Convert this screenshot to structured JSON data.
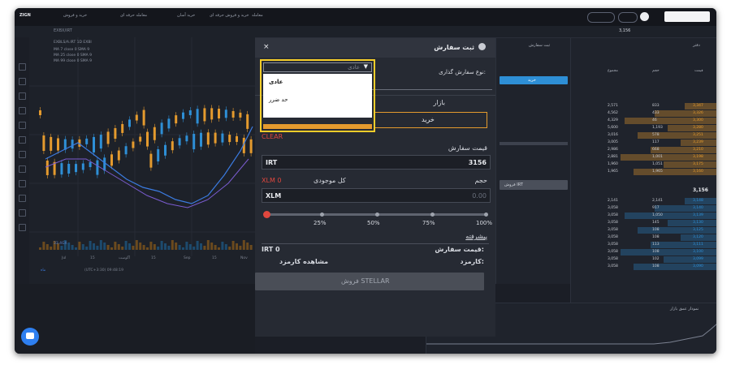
{
  "colors": {
    "accent": "#f5cd2a",
    "buy_orange": "#e49a2e",
    "sell_blue": "#2e8fd6",
    "clear_red": "#e0473e",
    "modal_bg": "#262a33",
    "page_bg": "#1b1e26"
  },
  "topbar": {
    "logo": "ZIGN",
    "items": [
      "خرید و فروش",
      "معامله حرفه ای",
      "خرید آسان",
      "خرید و فروش حرفه ای",
      "معامله"
    ]
  },
  "chart": {
    "pair": "EXBX/IRT",
    "ticker_row": "EXBLS/A.IRT 1D EXBI",
    "ind1": "MA 7 close 0 SMA 9",
    "ind2": "MA 25 close 0 SMA 9",
    "ind3": "MA 99 close 0 SMA 9",
    "volume": "33.4GX",
    "x_ticks": [
      "Jul",
      "15",
      "آگوست",
      "15",
      "Sep",
      "15",
      "Nov"
    ],
    "footer": "(UTC+3:30) 09:48:19",
    "footer_left": "ماه"
  },
  "modal": {
    "title": "ثبت سفارش",
    "close_icon": "×",
    "order_type_label": "نوع سفارش گذاری:",
    "order_type_value": "عادی",
    "dropdown_options": [
      "عادی",
      "حد ضرر"
    ],
    "market_tab": "بازار",
    "buy_tab": "خرید",
    "clear_label": "CLEAR",
    "price_label": "قیمت سفارش",
    "price_currency": "IRT",
    "price_value": "3156",
    "volume_label": "حجم",
    "balance_label": "کل موجودی",
    "balance_value": "XLM 0",
    "volume_currency": "XLM",
    "volume_value": "0.00",
    "slider_marks": [
      "25%",
      "50%",
      "75%",
      "100%"
    ],
    "slider_value": 0,
    "advanced_link": "پیشرفته",
    "order_price_label": "قیمت سفارش:",
    "order_price_value": "IRT 0",
    "fee_label": "کارمزد:",
    "fee_value": "مشاهده کارمزد",
    "sell_button": "فروش STELLAR"
  },
  "orderbook": {
    "title": "دفتر",
    "headers": [
      "قیمت",
      "حجم",
      "مجموع"
    ],
    "last_price": "3,156",
    "asks": [
      [
        "3,347",
        "833",
        "2,571"
      ],
      [
        "3,326",
        "433",
        "4,562"
      ],
      [
        "3,300",
        "46",
        "4,329"
      ],
      [
        "3,280",
        "1,193",
        "5,600"
      ],
      [
        "3,251",
        "578",
        "3,016"
      ],
      [
        "3,239",
        "117",
        "3,005"
      ],
      [
        "3,210",
        "668",
        "2,986"
      ],
      [
        "3,198",
        "1,001",
        "2,881"
      ],
      [
        "3,175",
        "1,051",
        "1,960"
      ],
      [
        "3,160",
        "1,965",
        "1,965"
      ]
    ],
    "bids": [
      [
        "3,148",
        "2,141",
        "2,141"
      ],
      [
        "3,140",
        "917",
        "3,058"
      ],
      [
        "3,139",
        "1,050",
        "3,058"
      ],
      [
        "3,130",
        "145",
        "3,058"
      ],
      [
        "3,125",
        "108",
        "3,058"
      ],
      [
        "3,120",
        "108",
        "3,058"
      ],
      [
        "3,111",
        "113",
        "3,058"
      ],
      [
        "3,100",
        "108",
        "3,058"
      ],
      [
        "3,099",
        "102",
        "3,058"
      ],
      [
        "3,090",
        "108",
        "3,058"
      ]
    ]
  },
  "order_panel": {
    "title": "ثبت سفارش",
    "buy_button": "خرید",
    "sell_button": "فروش IRT"
  },
  "depth_chart": {
    "title": "نمودار عمق بازار"
  }
}
